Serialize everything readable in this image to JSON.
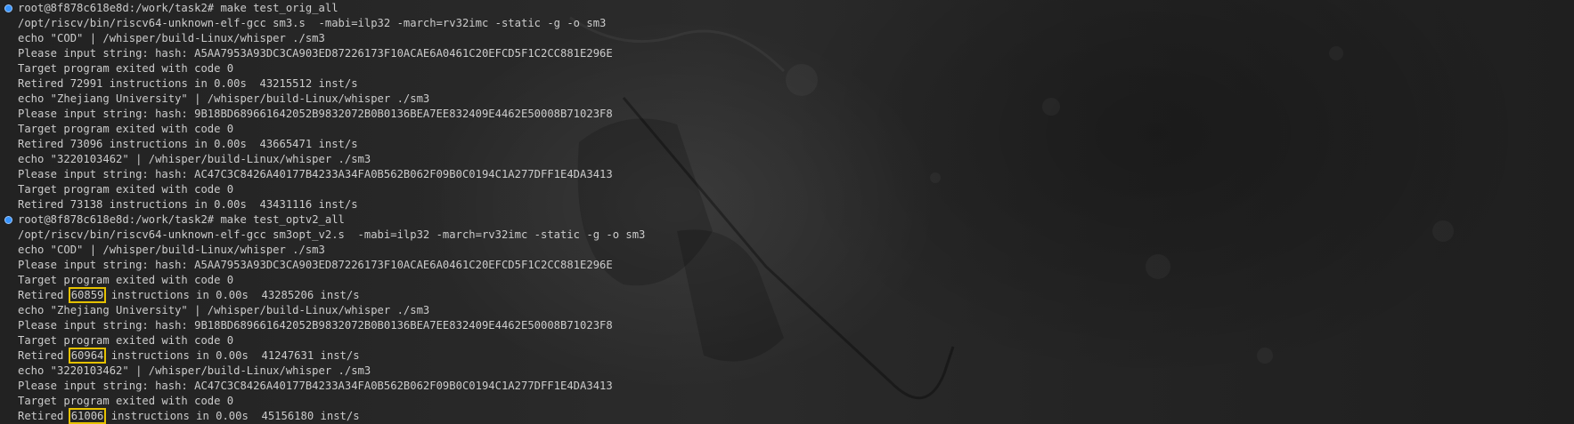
{
  "terminal": {
    "lines": [
      {
        "type": "prompt",
        "prompt": "root@8f878c618e8d:/work/task2# ",
        "command": "make test_orig_all"
      },
      {
        "type": "out",
        "text": "/opt/riscv/bin/riscv64-unknown-elf-gcc sm3.s  -mabi=ilp32 -march=rv32imc -static -g -o sm3"
      },
      {
        "type": "out",
        "text": "echo \"COD\" | /whisper/build-Linux/whisper ./sm3"
      },
      {
        "type": "out",
        "text": "Please input string: hash: A5AA7953A93DC3CA903ED87226173F10ACAE6A0461C20EFCD5F1C2CC881E296E"
      },
      {
        "type": "out",
        "text": "Target program exited with code 0"
      },
      {
        "type": "retired",
        "prefix": "Retired ",
        "count": "72991",
        "suffix": " instructions in 0.00s  43215512 inst/s"
      },
      {
        "type": "out",
        "text": "echo \"Zhejiang University\" | /whisper/build-Linux/whisper ./sm3"
      },
      {
        "type": "out",
        "text": "Please input string: hash: 9B18BD689661642052B9832072B0B0136BEA7EE832409E4462E50008B71023F8"
      },
      {
        "type": "out",
        "text": "Target program exited with code 0"
      },
      {
        "type": "retired",
        "prefix": "Retired ",
        "count": "73096",
        "suffix": " instructions in 0.00s  43665471 inst/s"
      },
      {
        "type": "out",
        "text": "echo \"3220103462\" | /whisper/build-Linux/whisper ./sm3"
      },
      {
        "type": "out",
        "text": "Please input string: hash: AC47C3C8426A40177B4233A34FA0B562B062F09B0C0194C1A277DFF1E4DA3413"
      },
      {
        "type": "out",
        "text": "Target program exited with code 0"
      },
      {
        "type": "retired",
        "prefix": "Retired ",
        "count": "73138",
        "suffix": " instructions in 0.00s  43431116 inst/s"
      },
      {
        "type": "prompt",
        "prompt": "root@8f878c618e8d:/work/task2# ",
        "command": "make test_optv2_all"
      },
      {
        "type": "out",
        "text": "/opt/riscv/bin/riscv64-unknown-elf-gcc sm3opt_v2.s  -mabi=ilp32 -march=rv32imc -static -g -o sm3"
      },
      {
        "type": "out",
        "text": "echo \"COD\" | /whisper/build-Linux/whisper ./sm3"
      },
      {
        "type": "out",
        "text": "Please input string: hash: A5AA7953A93DC3CA903ED87226173F10ACAE6A0461C20EFCD5F1C2CC881E296E"
      },
      {
        "type": "out",
        "text": "Target program exited with code 0"
      },
      {
        "type": "retired",
        "prefix": "Retired ",
        "count": "60859",
        "suffix": " instructions in 0.00s  43285206 inst/s",
        "highlight": true
      },
      {
        "type": "out",
        "text": "echo \"Zhejiang University\" | /whisper/build-Linux/whisper ./sm3"
      },
      {
        "type": "out",
        "text": "Please input string: hash: 9B18BD689661642052B9832072B0B0136BEA7EE832409E4462E50008B71023F8"
      },
      {
        "type": "out",
        "text": "Target program exited with code 0"
      },
      {
        "type": "retired",
        "prefix": "Retired ",
        "count": "60964",
        "suffix": " instructions in 0.00s  41247631 inst/s",
        "highlight": true
      },
      {
        "type": "out",
        "text": "echo \"3220103462\" | /whisper/build-Linux/whisper ./sm3"
      },
      {
        "type": "out",
        "text": "Please input string: hash: AC47C3C8426A40177B4233A34FA0B562B062F09B0C0194C1A277DFF1E4DA3413"
      },
      {
        "type": "out",
        "text": "Target program exited with code 0"
      },
      {
        "type": "retired",
        "prefix": "Retired ",
        "count": "61006",
        "suffix": " instructions in 0.00s  45156180 inst/s",
        "highlight": true
      }
    ]
  },
  "colors": {
    "background": "#262626",
    "text": "#cccccc",
    "prompt_dot": "#3794ff",
    "highlight_box": "#e5c100"
  },
  "icons": {
    "prompt_marker": "prompt-dot-icon"
  }
}
